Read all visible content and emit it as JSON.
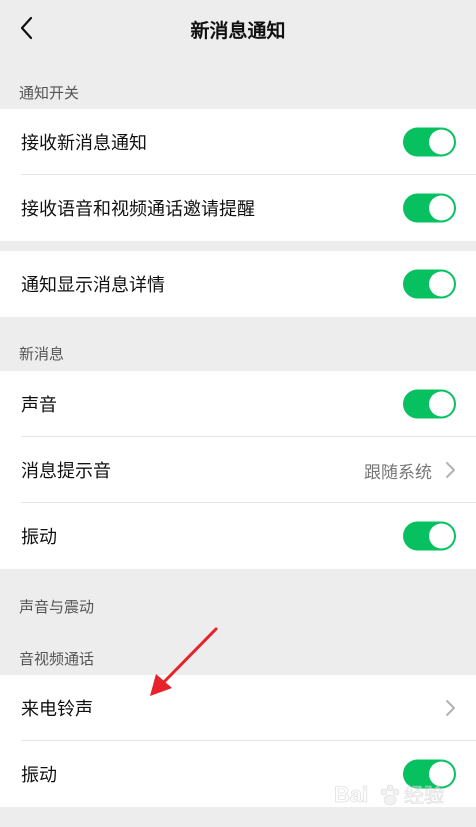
{
  "nav": {
    "title": "新消息通知",
    "back_icon": "chevron-left-icon"
  },
  "sections": {
    "notify_switch": "通知开关",
    "new_message": "新消息",
    "sound_vibration": "声音与震动",
    "av_call": "音视频通话"
  },
  "rows": {
    "receive_new_msg": {
      "label": "接收新消息通知",
      "toggle_on": true
    },
    "receive_call_invite": {
      "label": "接收语音和视频通话邀请提醒",
      "toggle_on": true
    },
    "show_msg_detail": {
      "label": "通知显示消息详情",
      "toggle_on": true
    },
    "sound": {
      "label": "声音",
      "toggle_on": true
    },
    "msg_tone": {
      "label": "消息提示音",
      "value": "跟随系统"
    },
    "vibration": {
      "label": "振动",
      "toggle_on": true
    },
    "ringtone": {
      "label": "来电铃声"
    },
    "call_vibration": {
      "label": "振动",
      "toggle_on": true
    }
  },
  "colors": {
    "toggle_on": "#07c160",
    "annotation_arrow": "#e8222a"
  },
  "watermark": "Bai 经验"
}
